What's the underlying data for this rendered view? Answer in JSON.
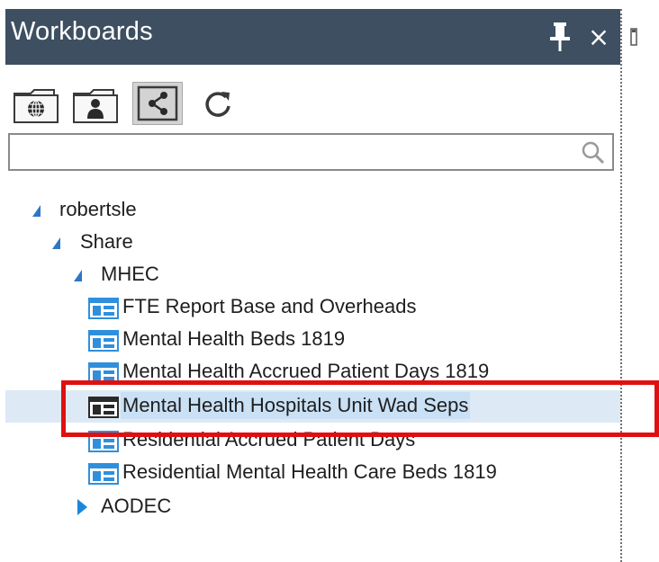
{
  "panel": {
    "title": "Workboards",
    "close_glyph": "×",
    "icons": {
      "pin": "pin-icon",
      "close": "close-icon"
    }
  },
  "toolbar": {
    "buttons": [
      {
        "name": "global-folder-button",
        "icon": "globe-folder-icon"
      },
      {
        "name": "user-folder-button",
        "icon": "user-folder-icon"
      },
      {
        "name": "shared-button",
        "icon": "share-icon",
        "active": true
      },
      {
        "name": "refresh-button",
        "icon": "refresh-icon"
      }
    ]
  },
  "search": {
    "value": "",
    "placeholder": "",
    "icon": "search-icon"
  },
  "tree": {
    "root": "robertsle",
    "share": "Share",
    "mhec": "MHEC",
    "items": [
      "FTE Report Base and Overheads",
      "Mental Health Beds 1819",
      "Mental Health  Accrued Patient Days 1819",
      "Mental Health Hospitals Unit Wad Seps",
      "Residential Accrued Patient Days",
      "Residential Mental Health Care Beds 1819"
    ],
    "selected_index": 3,
    "aodec": "AODEC"
  },
  "colors": {
    "titlebar": "#3d4f61",
    "tree_arrow": "#2e76c7",
    "selection": "#ddeaf6",
    "annotation": "#e01010",
    "workboard_icon": "#2f8fdc"
  }
}
